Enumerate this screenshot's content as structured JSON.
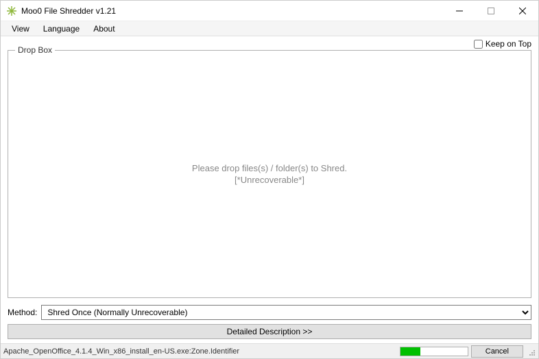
{
  "window": {
    "title": "Moo0 File Shredder v1.21"
  },
  "menu": {
    "view": "View",
    "language": "Language",
    "about": "About"
  },
  "options": {
    "keep_on_top_label": "Keep on Top",
    "keep_on_top_checked": false
  },
  "dropbox": {
    "legend": "Drop Box",
    "line1": "Please drop files(s) / folder(s) to Shred.",
    "line2": "[*Unrecoverable*]"
  },
  "method": {
    "label": "Method:",
    "selected": "Shred Once (Normally Unrecoverable)"
  },
  "detail_button": "Detailed Description >>",
  "status": {
    "text": "Apache_OpenOffice_4.1.4_Win_x86_install_en-US.exe:Zone.Identifier",
    "progress_percent": 30,
    "cancel_label": "Cancel"
  }
}
